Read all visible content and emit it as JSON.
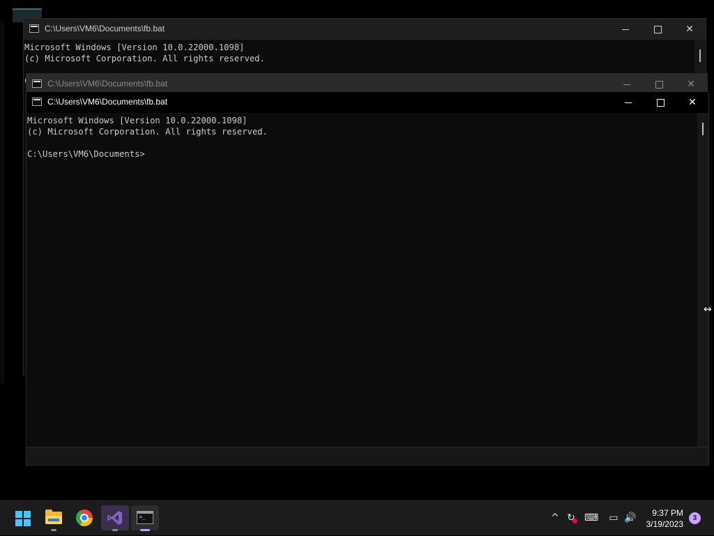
{
  "windows": [
    {
      "title": "C:\\Users\\VM6\\Documents\\fb.bat",
      "lines": [
        "Microsoft Windows [Version 10.0.22000.1098]",
        "(c) Microsoft Corporation. All rights reserved.",
        "",
        "C:"
      ],
      "state": "inactive"
    },
    {
      "title": "C:\\Users\\VM6\\Documents\\fb.bat",
      "state": "inactive"
    },
    {
      "title": "C:\\Users\\VM6\\Documents\\fb.bat",
      "lines": [
        "Microsoft Windows [Version 10.0.22000.1098]",
        "(c) Microsoft Corporation. All rights reserved.",
        "",
        "C:\\Users\\VM6\\Documents>"
      ],
      "state": "active"
    }
  ],
  "window_controls": {
    "minimize": "—",
    "maximize": "☐",
    "close": "✕"
  },
  "taskbar": {
    "apps": [
      {
        "name": "Start",
        "icon": "windows-start-icon"
      },
      {
        "name": "File Explorer",
        "icon": "file-explorer-icon",
        "running": true
      },
      {
        "name": "Google Chrome",
        "icon": "chrome-icon",
        "running": true
      },
      {
        "name": "Visual Studio",
        "icon": "visual-studio-icon",
        "running": true
      },
      {
        "name": "Command Prompt",
        "icon": "command-prompt-icon",
        "running": true,
        "active": true
      }
    ],
    "tray": {
      "chevron": "^",
      "icons": [
        "show-hidden-icons",
        "sync-icon",
        "keyboard-icon",
        "network-icon",
        "volume-icon"
      ],
      "time": "9:37 PM",
      "date": "3/19/2023",
      "notification_count": "3"
    }
  },
  "colors": {
    "console_bg": "#0c0c0c",
    "console_text": "#cccccc",
    "taskbar_bg": "#1c1c1c",
    "accent": "#c8a2ff",
    "start_blue": "#4cc2ff"
  }
}
